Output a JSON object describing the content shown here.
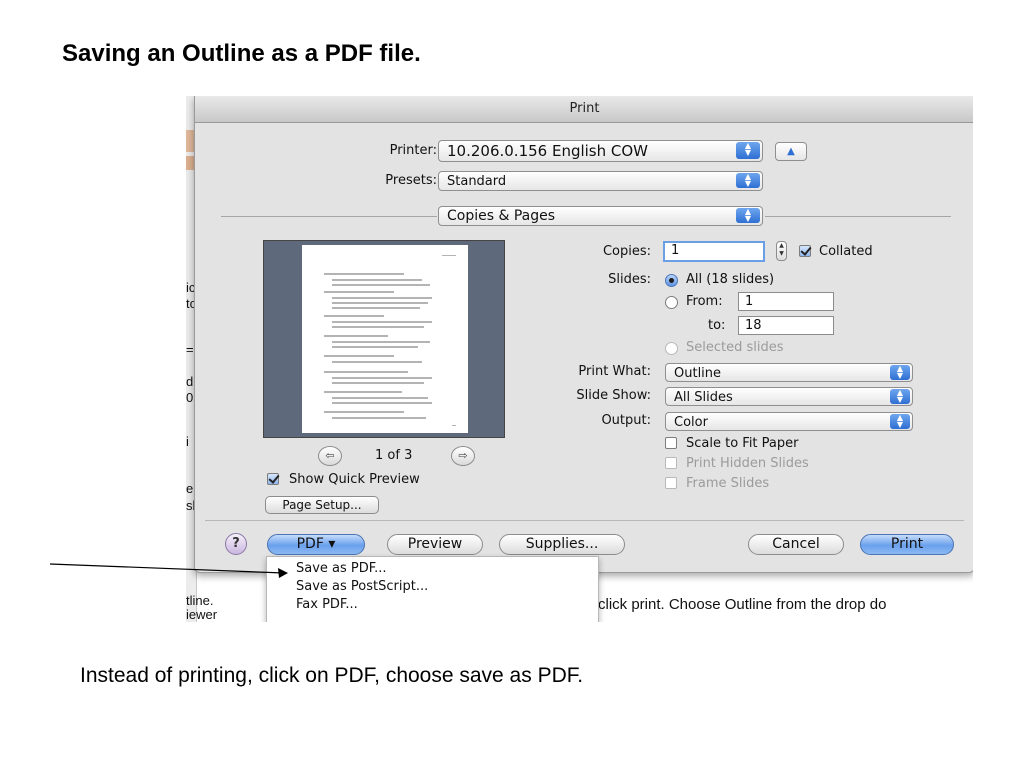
{
  "slide": {
    "title": "Saving an Outline as a PDF file.",
    "caption": "Instead of printing, click on PDF, choose save as PDF."
  },
  "background_window": {
    "fragments": [
      "ic",
      "to",
      "=",
      "d",
      "0",
      "i",
      "e",
      "sl"
    ],
    "bottom_left_1": "tline.",
    "bottom_left_2": "iewer",
    "bottom_text": "click print.  Choose Outline from the drop do"
  },
  "dialog": {
    "title": "Print",
    "printer": {
      "label": "Printer:",
      "value": "10.206.0.156 English COW"
    },
    "presets": {
      "label": "Presets:",
      "value": "Standard"
    },
    "section": {
      "value": "Copies & Pages"
    },
    "copies": {
      "label": "Copies:",
      "value": "1",
      "collated_label": "Collated",
      "collated": true
    },
    "slides": {
      "label": "Slides:",
      "all_label": "All  (18 slides)",
      "from_label": "From:",
      "from_value": "1",
      "to_label": "to:",
      "to_value": "18",
      "selected_label": "Selected slides"
    },
    "print_what": {
      "label": "Print What:",
      "value": "Outline"
    },
    "slide_show": {
      "label": "Slide Show:",
      "value": "All Slides"
    },
    "output": {
      "label": "Output:",
      "value": "Color"
    },
    "options": {
      "scale_to_fit": "Scale to Fit Paper",
      "print_hidden": "Print Hidden Slides",
      "frame_slides": "Frame Slides"
    },
    "preview": {
      "page_indicator": "1 of 3",
      "show_quick_preview": "Show Quick Preview",
      "page_setup": "Page Setup..."
    },
    "buttons": {
      "help": "?",
      "pdf": "PDF ▾",
      "preview": "Preview",
      "supplies": "Supplies...",
      "cancel": "Cancel",
      "print": "Print"
    },
    "pdf_menu": {
      "items": [
        "Save as PDF...",
        "Save as PostScript...",
        "Fax PDF..."
      ]
    }
  },
  "colors": {
    "accent": "#3b7be0",
    "dialog_bg": "#e3e3e3",
    "preview_bg": "#5e6a7c"
  }
}
